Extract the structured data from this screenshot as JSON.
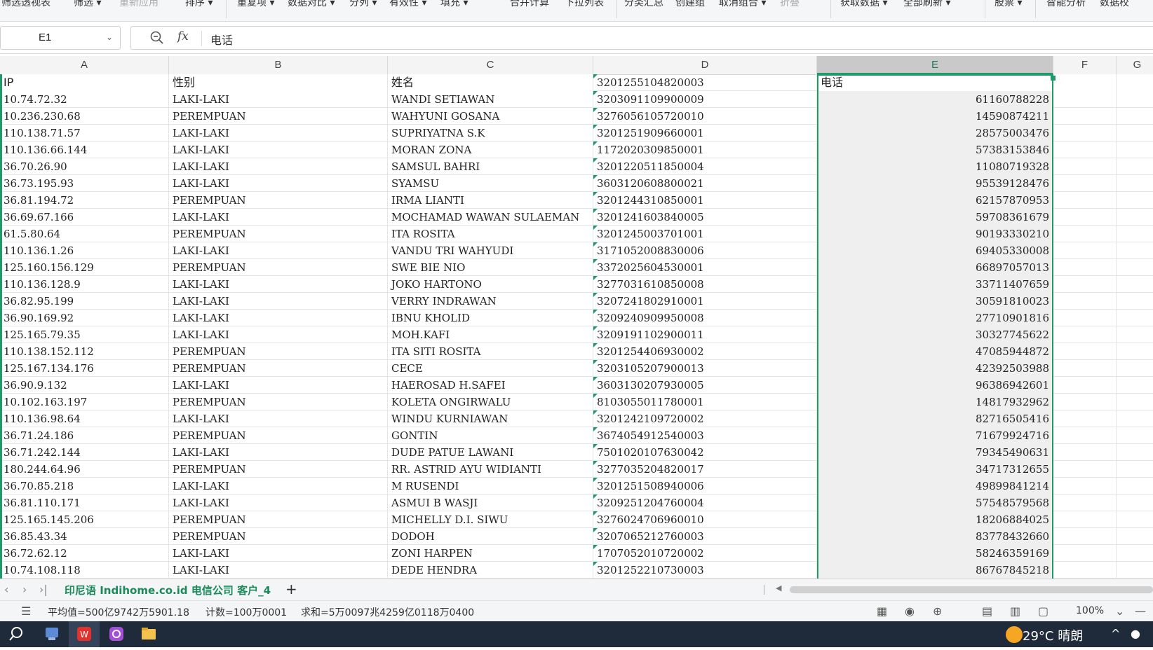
{
  "ribbon": {
    "items": [
      {
        "label": "筛选透视表",
        "dim": false
      },
      {
        "label": "筛选 ▾",
        "dim": false
      },
      {
        "label": "重新应用",
        "dim": true
      },
      {
        "label": "排序 ▾",
        "dim": false
      },
      {
        "label": "重复项 ▾",
        "dim": false
      },
      {
        "label": "数据对比 ▾",
        "dim": false
      },
      {
        "label": "分列 ▾",
        "dim": false
      },
      {
        "label": "有效性 ▾",
        "dim": false
      },
      {
        "label": "填充 ▾",
        "dim": false
      },
      {
        "label": "合并计算",
        "dim": false
      },
      {
        "label": "下拉列表",
        "dim": false
      },
      {
        "label": "分类汇总",
        "dim": false
      },
      {
        "label": "创建组",
        "dim": false
      },
      {
        "label": "取消组合 ▾",
        "dim": false
      },
      {
        "label": "折叠",
        "dim": true
      },
      {
        "label": "获取数据 ▾",
        "dim": false
      },
      {
        "label": "全部刷新 ▾",
        "dim": false
      },
      {
        "label": "股票 ▾",
        "dim": false
      },
      {
        "label": "智能分析",
        "dim": false
      },
      {
        "label": "数据校",
        "dim": false
      }
    ]
  },
  "namebox": {
    "value": "E1"
  },
  "formula_bar": {
    "fx": "fx",
    "value": "电话"
  },
  "columns": [
    "A",
    "B",
    "C",
    "D",
    "E",
    "F",
    "G"
  ],
  "selected_column": "E",
  "header_row": {
    "a": "IP",
    "b": "性别",
    "c": "姓名",
    "d": "3201255104820003",
    "e": "电话"
  },
  "rows": [
    {
      "a": "10.74.72.32",
      "b": "LAKI-LAKI",
      "c": "WANDI SETIAWAN",
      "d": "3203091109900009",
      "e": "61160788228"
    },
    {
      "a": "10.236.230.68",
      "b": "PEREMPUAN",
      "c": "WAHYUNI GOSANA",
      "d": "3276056105720010",
      "e": "14590874211"
    },
    {
      "a": "110.138.71.57",
      "b": "LAKI-LAKI",
      "c": "SUPRIYATNA S.K",
      "d": "3201251909660001",
      "e": "28575003476"
    },
    {
      "a": "110.136.66.144",
      "b": "LAKI-LAKI",
      "c": "MORAN ZONA",
      "d": "1172020309850001",
      "e": "57383153846"
    },
    {
      "a": "36.70.26.90",
      "b": "LAKI-LAKI",
      "c": "SAMSUL BAHRI",
      "d": "3201220511850004",
      "e": "11080719328"
    },
    {
      "a": "36.73.195.93",
      "b": "LAKI-LAKI",
      "c": "SYAMSU",
      "d": "3603120608800021",
      "e": "95539128476"
    },
    {
      "a": "36.81.194.72",
      "b": "PEREMPUAN",
      "c": "IRMA LIANTI",
      "d": "3201244310850001",
      "e": "62157870953"
    },
    {
      "a": "36.69.67.166",
      "b": "LAKI-LAKI",
      "c": "MOCHAMAD WAWAN SULAEMAN",
      "d": "3201241603840005",
      "e": "59708361679"
    },
    {
      "a": "61.5.80.64",
      "b": "PEREMPUAN",
      "c": "ITA ROSITA",
      "d": "3201245003701001",
      "e": "90193330210"
    },
    {
      "a": "110.136.1.26",
      "b": "LAKI-LAKI",
      "c": "VANDU TRI WAHYUDI",
      "d": "3171052008830006",
      "e": "69405330008"
    },
    {
      "a": "125.160.156.129",
      "b": "PEREMPUAN",
      "c": "SWE BIE NIO",
      "d": "3372025604530001",
      "e": "66897057013"
    },
    {
      "a": "110.136.128.9",
      "b": "LAKI-LAKI",
      "c": "JOKO HARTONO",
      "d": "3277031610850008",
      "e": "33711407659"
    },
    {
      "a": "36.82.95.199",
      "b": "LAKI-LAKI",
      "c": "VERRY INDRAWAN",
      "d": "3207241802910001",
      "e": "30591810023"
    },
    {
      "a": "36.90.169.92",
      "b": "LAKI-LAKI",
      "c": "IBNU KHOLID",
      "d": "3209240909950008",
      "e": "27710901816"
    },
    {
      "a": "125.165.79.35",
      "b": "LAKI-LAKI",
      "c": "MOH.KAFI",
      "d": "3209191102900011",
      "e": "30327745622"
    },
    {
      "a": "110.138.152.112",
      "b": "PEREMPUAN",
      "c": "ITA SITI ROSITA",
      "d": "3201254406930002",
      "e": "47085944872"
    },
    {
      "a": "125.167.134.176",
      "b": "PEREMPUAN",
      "c": "CECE",
      "d": "3203105207900013",
      "e": "42392503988"
    },
    {
      "a": "36.90.9.132",
      "b": "LAKI-LAKI",
      "c": "HAEROSAD H.SAFEI",
      "d": "3603130207930005",
      "e": "96386942601"
    },
    {
      "a": "10.102.163.197",
      "b": "PEREMPUAN",
      "c": "KOLETA ONGIRWALU",
      "d": "8103055011780001",
      "e": "14817932962"
    },
    {
      "a": "110.136.98.64",
      "b": "LAKI-LAKI",
      "c": "WINDU KURNIAWAN",
      "d": "3201242109720002",
      "e": "82716505416"
    },
    {
      "a": "36.71.24.186",
      "b": "PEREMPUAN",
      "c": "GONTIN",
      "d": "3674054912540003",
      "e": "71679924716"
    },
    {
      "a": "36.71.242.144",
      "b": "LAKI-LAKI",
      "c": "DUDE PATUE LAWANI",
      "d": "7501020107630042",
      "e": "79345490631"
    },
    {
      "a": "180.244.64.96",
      "b": "PEREMPUAN",
      "c": "RR. ASTRID AYU WIDIANTI",
      "d": "3277035204820017",
      "e": "34717312655"
    },
    {
      "a": "36.70.85.218",
      "b": "LAKI-LAKI",
      "c": "M RUSENDI",
      "d": "3201251508940006",
      "e": "49899841214"
    },
    {
      "a": "36.81.110.171",
      "b": "LAKI-LAKI",
      "c": "ASMUI B WASJI",
      "d": "3209251204760004",
      "e": "57548579568"
    },
    {
      "a": "125.165.145.206",
      "b": "PEREMPUAN",
      "c": "MICHELLY D.I. SIWU",
      "d": "3276024706960010",
      "e": "18206884025"
    },
    {
      "a": "36.85.43.34",
      "b": "PEREMPUAN",
      "c": "DODOH",
      "d": "3207065212760003",
      "e": "83778432660"
    },
    {
      "a": "36.72.62.12",
      "b": "LAKI-LAKI",
      "c": "ZONI HARPEN",
      "d": "1707052010720002",
      "e": "58246359169"
    },
    {
      "a": "10.74.108.118",
      "b": "LAKI-LAKI",
      "c": "DEDE HENDRA",
      "d": "3201252210730003",
      "e": "86767845218"
    }
  ],
  "sheet_tab": "印尼语 Indihome.co.id 电信公司 客户_4",
  "status": {
    "average": "平均值=500亿9742万5901.18",
    "count": "计数=100万0001",
    "sum": "求和=5万0097兆4259亿0118万0400",
    "zoom": "100%"
  },
  "taskbar": {
    "weather": "29°C 晴朗"
  },
  "colors": {
    "accent": "#1f9a68",
    "selected_header": "#c9c9c9",
    "taskbar": "#1f2a3a"
  }
}
